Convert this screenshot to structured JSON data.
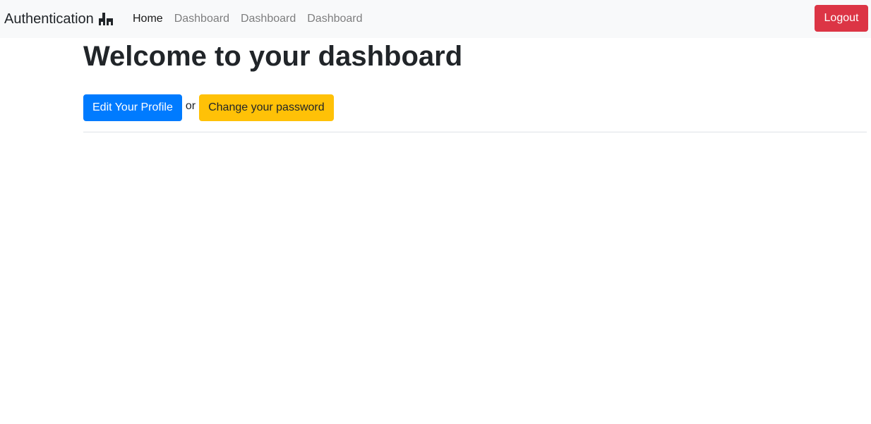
{
  "navbar": {
    "brand": "Authentication",
    "brand_icon": "building-icon",
    "links": [
      {
        "label": "Home",
        "active": true
      },
      {
        "label": "Dashboard",
        "active": false
      },
      {
        "label": "Dashboard",
        "active": false
      },
      {
        "label": "Dashboard",
        "active": false
      }
    ],
    "logout_label": "Logout"
  },
  "main": {
    "title": "Welcome to your dashboard",
    "edit_profile_label": "Edit Your Profile",
    "or_text": "or",
    "change_password_label": "Change your password"
  },
  "colors": {
    "navbar_bg": "#f8f9fa",
    "primary": "#007bff",
    "warning": "#ffc107",
    "danger": "#dc3545"
  }
}
